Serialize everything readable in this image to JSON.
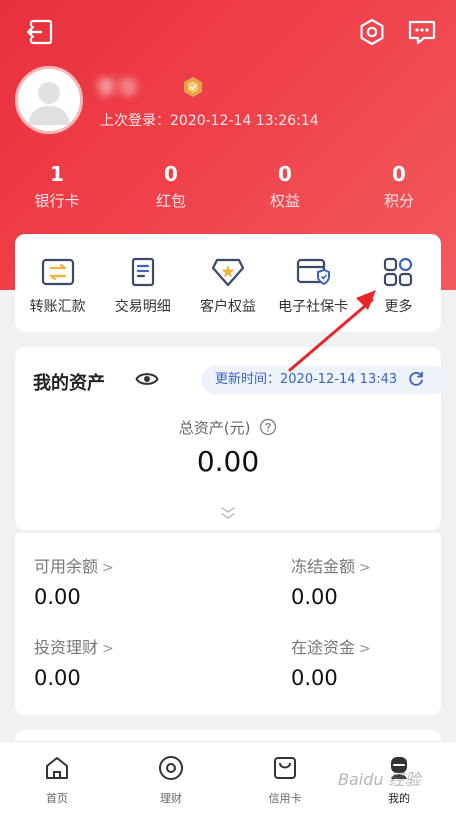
{
  "user": {
    "name": "李华",
    "last_login": "上次登录：2020-12-14 13:26:14"
  },
  "stats": [
    {
      "value": "1",
      "label": "银行卡"
    },
    {
      "value": "0",
      "label": "红包"
    },
    {
      "value": "0",
      "label": "权益"
    },
    {
      "value": "0",
      "label": "积分"
    }
  ],
  "shortcuts": [
    {
      "label": "转账汇款",
      "icon": "transfer-icon"
    },
    {
      "label": "交易明细",
      "icon": "statement-icon"
    },
    {
      "label": "客户权益",
      "icon": "diamond-icon"
    },
    {
      "label": "电子社保卡",
      "icon": "social-card-icon"
    },
    {
      "label": "更多",
      "icon": "grid-icon"
    }
  ],
  "assets": {
    "title": "我的资产",
    "update_time": "更新时间：2020-12-14 13:43",
    "total_label": "总资产(元)",
    "total_value": "0.00"
  },
  "balances": {
    "available_label": "可用余额",
    "available_value": "0.00",
    "frozen_label": "冻结金额",
    "frozen_value": "0.00",
    "invest_label": "投资理财",
    "invest_value": "0.00",
    "transit_label": "在途资金",
    "transit_value": "0.00"
  },
  "tabs": [
    {
      "label": "首页",
      "icon": "home-icon"
    },
    {
      "label": "理财",
      "icon": "wealth-icon"
    },
    {
      "label": "信用卡",
      "icon": "credit-card-icon"
    },
    {
      "label": "我的",
      "icon": "profile-icon"
    }
  ],
  "watermark": "Baidu 经验",
  "colors": {
    "header_red": "#ea3340",
    "accent_blue": "#3b63c4",
    "annotation_red": "#e8262a"
  }
}
